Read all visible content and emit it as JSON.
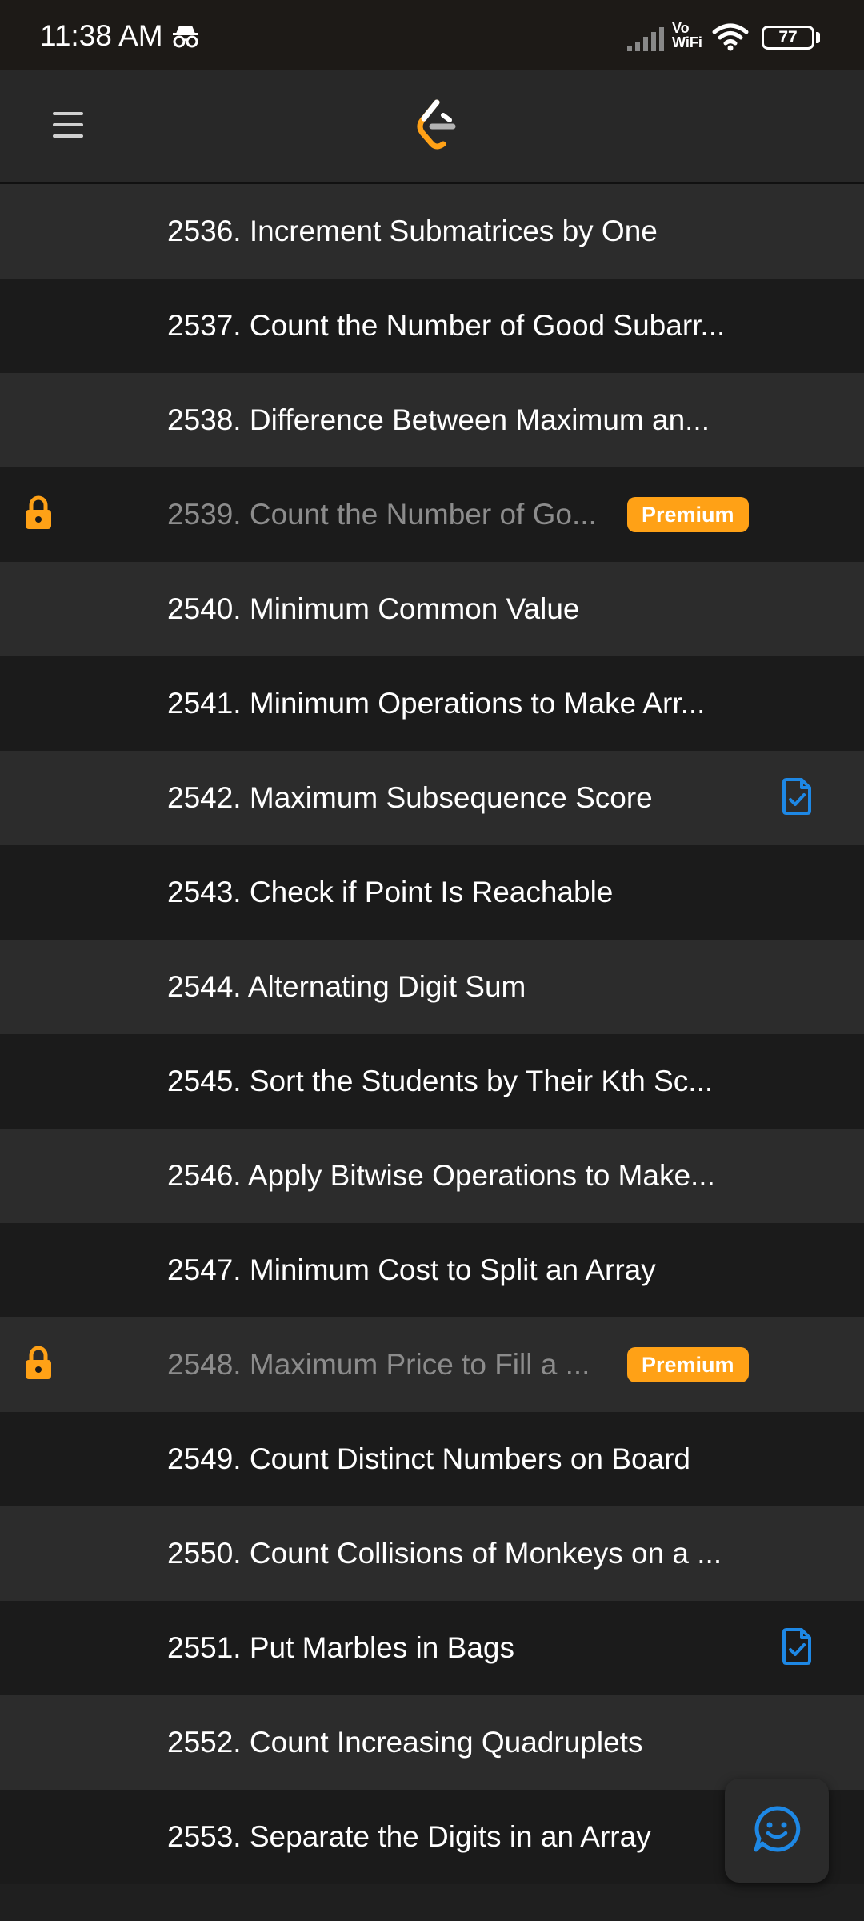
{
  "status_bar": {
    "time": "11:38 AM",
    "network_label": "Vo\nWiFi",
    "battery": "77"
  },
  "header": {
    "menu_icon": "hamburger-menu-icon",
    "logo_icon": "leetcode-logo-icon"
  },
  "colors": {
    "premium": "#ffa116",
    "solved": "#1e88e5",
    "row_light": "#2c2c2c",
    "row_dark": "#1b1b1b"
  },
  "problems": [
    {
      "title": "2536. Increment Submatrices by One",
      "locked": false,
      "premium": "",
      "solved": false
    },
    {
      "title": "2537. Count the Number of Good Subarr...",
      "locked": false,
      "premium": "",
      "solved": false
    },
    {
      "title": "2538. Difference Between Maximum an...",
      "locked": false,
      "premium": "",
      "solved": false
    },
    {
      "title": "2539. Count the Number of Go...",
      "locked": true,
      "premium": "Premium",
      "solved": false
    },
    {
      "title": "2540. Minimum Common Value",
      "locked": false,
      "premium": "",
      "solved": false
    },
    {
      "title": "2541. Minimum Operations to Make Arr...",
      "locked": false,
      "premium": "",
      "solved": false
    },
    {
      "title": "2542. Maximum Subsequence Score",
      "locked": false,
      "premium": "",
      "solved": true
    },
    {
      "title": "2543. Check if Point Is Reachable",
      "locked": false,
      "premium": "",
      "solved": false
    },
    {
      "title": "2544. Alternating Digit Sum",
      "locked": false,
      "premium": "",
      "solved": false
    },
    {
      "title": "2545. Sort the Students by Their Kth Sc...",
      "locked": false,
      "premium": "",
      "solved": false
    },
    {
      "title": "2546. Apply Bitwise Operations to Make...",
      "locked": false,
      "premium": "",
      "solved": false
    },
    {
      "title": "2547. Minimum Cost to Split an Array",
      "locked": false,
      "premium": "",
      "solved": false
    },
    {
      "title": "2548. Maximum Price to Fill a ...",
      "locked": true,
      "premium": "Premium",
      "solved": false
    },
    {
      "title": "2549. Count Distinct Numbers on Board",
      "locked": false,
      "premium": "",
      "solved": false
    },
    {
      "title": "2550. Count Collisions of Monkeys on a ...",
      "locked": false,
      "premium": "",
      "solved": false
    },
    {
      "title": "2551. Put Marbles in Bags",
      "locked": false,
      "premium": "",
      "solved": true
    },
    {
      "title": "2552. Count Increasing Quadruplets",
      "locked": false,
      "premium": "",
      "solved": false
    },
    {
      "title": "2553. Separate the Digits in an Array",
      "locked": false,
      "premium": "",
      "solved": false
    }
  ],
  "fab": {
    "icon": "chat-smile-icon"
  }
}
